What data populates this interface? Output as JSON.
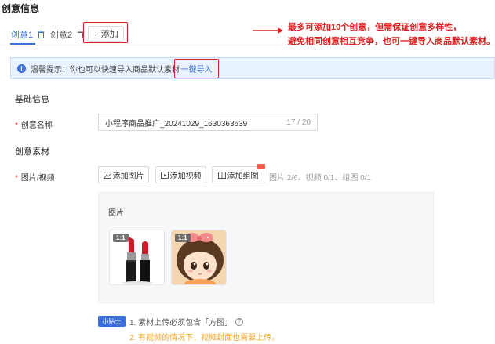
{
  "section_title": "创意信息",
  "tabs": [
    {
      "label": "创意1",
      "active": true
    },
    {
      "label": "创意2",
      "active": false
    }
  ],
  "add_tab_label": "+ 添加",
  "annotation": {
    "line1": "最多可添加10个创意，但需保证创意多样性，",
    "line2": "避免相同创意相互竞争，也可一键导入商品默认素材。"
  },
  "notice": {
    "text": "温馨提示：你也可以快速导入商品默认素材",
    "link": "一键导入"
  },
  "basic_info": {
    "title": "基础信息",
    "name_label": "创意名称",
    "name_value": "小程序商品推广_20241029_1630363639",
    "name_counter": "17 / 20"
  },
  "material": {
    "title": "创意素材",
    "field_label": "图片/视频",
    "buttons": {
      "add_image": "添加图片",
      "add_video": "添加视频",
      "add_group": "添加组图"
    },
    "stats": "图片 2/6、视频 0/1、组图 0/1",
    "panel_label": "图片",
    "thumbnails": [
      {
        "ratio": "1:1",
        "subject": "lipstick-image"
      },
      {
        "ratio": "1:1",
        "subject": "girl-illustration-image"
      }
    ]
  },
  "tips": {
    "badge": "小贴士",
    "tip1": "1. 素材上传必须包含「方图」",
    "tip2": "2. 有视频的情况下，视频封面也需要上传。"
  },
  "colors": {
    "accent": "#3b6fe0",
    "annotation_red": "#e02020",
    "warning_orange": "#f5a623"
  }
}
